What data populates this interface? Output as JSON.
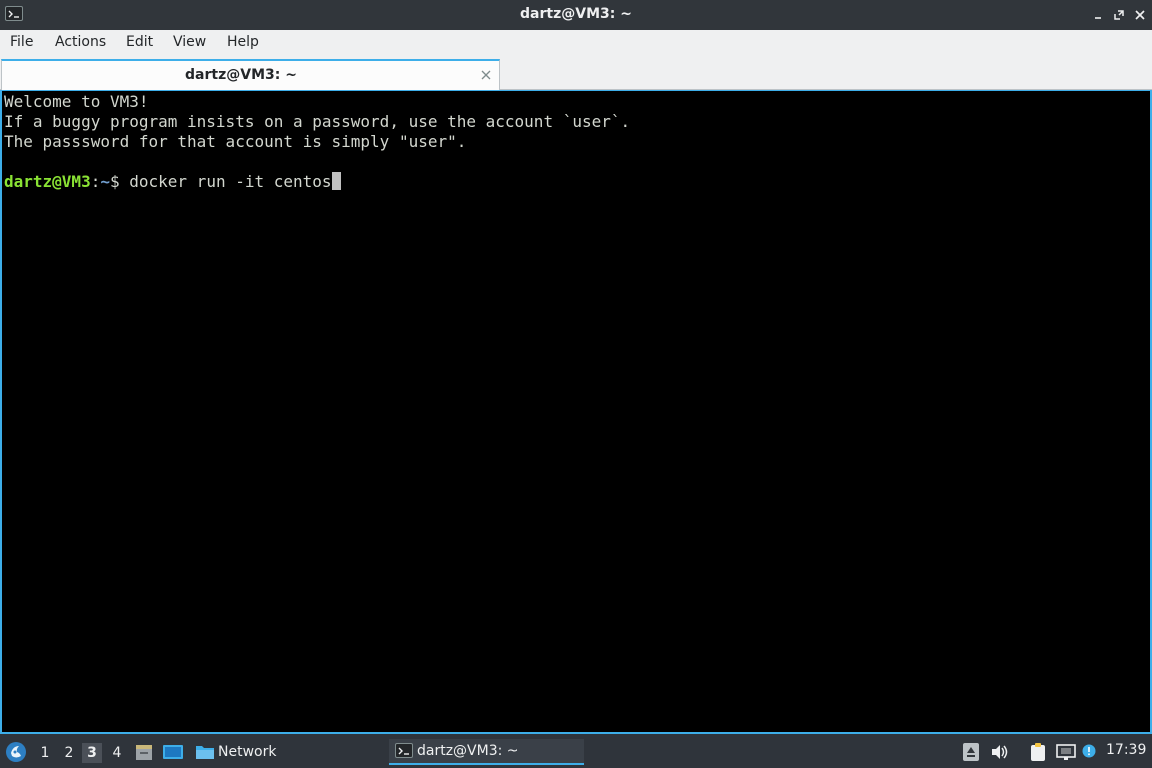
{
  "window": {
    "title": "dartz@VM3: ~"
  },
  "menu": [
    "File",
    "Actions",
    "Edit",
    "View",
    "Help"
  ],
  "tabs": [
    {
      "label": "dartz@VM3: ~",
      "active": true
    }
  ],
  "terminal": {
    "lines": [
      "Welcome to VM3!",
      "If a buggy program insists on a password, use the account `user`.",
      "The passsword for that account is simply \"user\"."
    ],
    "prompt": {
      "user_host": "dartz@VM3",
      "colon": ":",
      "path": "~",
      "symbol": "$ ",
      "command": "docker run -it centos"
    }
  },
  "taskbar": {
    "workspaces": [
      "1",
      "2",
      "3",
      "4"
    ],
    "active_workspace": "3",
    "network_label": "Network",
    "task_label": "dartz@VM3: ~",
    "clock": "17:39"
  },
  "colors": {
    "accent": "#3daee9",
    "prompt_user": "#8ae234",
    "prompt_path": "#729fcf",
    "terminal_bg": "#000000",
    "titlebar_bg": "#31363b",
    "taskbar_bg": "#2f343b"
  },
  "icons": {
    "titlebar": [
      "terminal-icon",
      "minimize-icon",
      "maximize-icon",
      "close-icon"
    ],
    "tab": [
      "tab-close-icon"
    ],
    "taskbar": [
      "start-menu-icon",
      "file-manager-icon",
      "desktop-icon",
      "folder-icon",
      "terminal-icon",
      "tray-up-arrow-icon",
      "volume-icon",
      "clipboard-icon",
      "network-icon",
      "notification-icon"
    ]
  }
}
